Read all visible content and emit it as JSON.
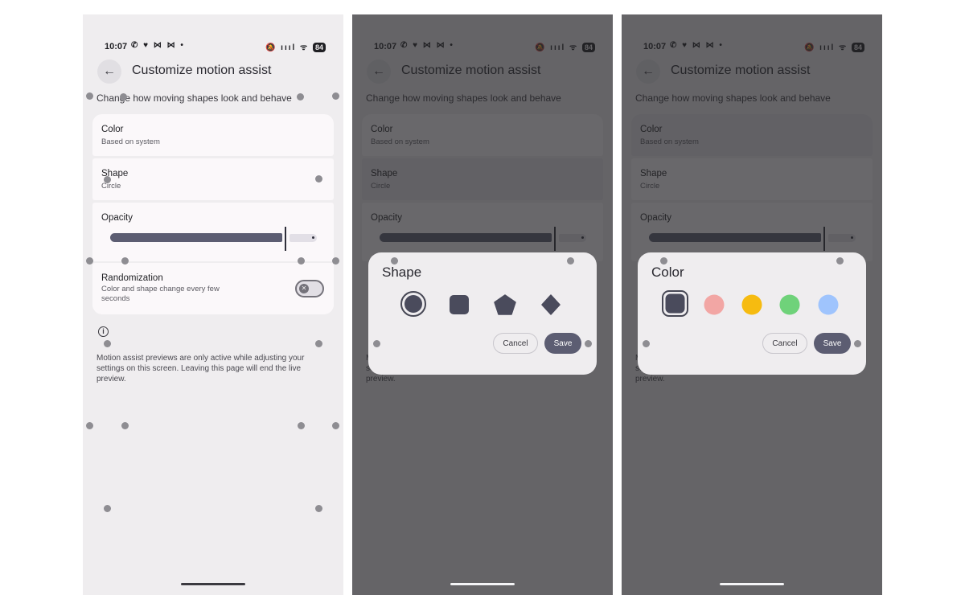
{
  "status_bar": {
    "time": "10:07",
    "notif_icons": "✆ ♥ ⋈ ⋈ •",
    "right_icons": "🔕 ıııl ᯤ",
    "battery": "84"
  },
  "header": {
    "back_icon": "arrow-left-icon",
    "title": "Customize motion assist"
  },
  "subtitle": "Change how moving shapes look and behave",
  "settings": {
    "color": {
      "label": "Color",
      "value": "Based on system"
    },
    "shape": {
      "label": "Shape",
      "value": "Circle"
    },
    "opacity": {
      "label": "Opacity",
      "level": 0.82
    },
    "randomization": {
      "label": "Randomization",
      "value": "Color and shape change every few seconds",
      "enabled": false
    }
  },
  "info": {
    "icon": "info-icon",
    "text": "Motion assist previews are only active while adjusting your settings on this screen. Leaving this page will end the live preview."
  },
  "shape_dialog": {
    "title": "Shape",
    "options": [
      "circle",
      "square",
      "pentagon",
      "diamond"
    ],
    "selected": "circle",
    "cancel": "Cancel",
    "save": "Save"
  },
  "color_dialog": {
    "title": "Color",
    "options": [
      {
        "name": "dark",
        "hex": "#4a4b5c"
      },
      {
        "name": "pink",
        "hex": "#f2a6a4"
      },
      {
        "name": "yellow",
        "hex": "#f6bb10"
      },
      {
        "name": "green",
        "hex": "#6fd27a"
      },
      {
        "name": "blue",
        "hex": "#9fc4fd"
      }
    ],
    "selected": "dark",
    "cancel": "Cancel",
    "save": "Save"
  },
  "colors": {
    "accent": "#5c5d72",
    "background": "#efedef",
    "card": "#fbf8fa"
  }
}
